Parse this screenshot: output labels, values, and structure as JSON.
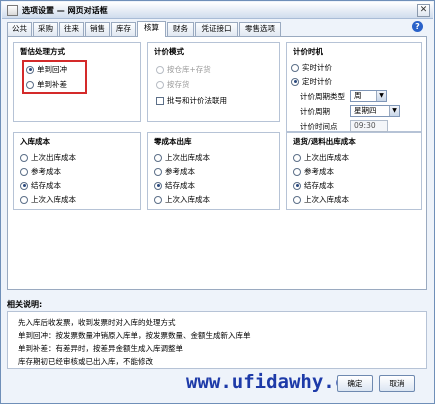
{
  "window": {
    "title": "选项设置 — 网页对话框",
    "close_glyph": "✕"
  },
  "help_glyph": "?",
  "tabs": [
    {
      "label": "公共"
    },
    {
      "label": "采购"
    },
    {
      "label": "往来"
    },
    {
      "label": "销售"
    },
    {
      "label": "库存"
    },
    {
      "label": "核算"
    },
    {
      "label": "财务"
    },
    {
      "label": "凭证接口"
    },
    {
      "label": "零售选项"
    }
  ],
  "active_tab": "核算",
  "group_temp": {
    "title": "暂估处理方式",
    "options": [
      "单到回冲",
      "单到补差"
    ],
    "selected": "单到回冲"
  },
  "group_pricing": {
    "title": "计价模式",
    "options": [
      "按仓库+存货",
      "按存货"
    ],
    "checkbox": "批号和计价法联用"
  },
  "group_timing": {
    "title": "计价时机",
    "options": [
      "实时计价",
      "定时计价"
    ],
    "selected": "定时计价",
    "period_type_label": "计价周期类型",
    "period_type_value": "周",
    "period_label": "计价周期",
    "period_value": "星期四",
    "time_label": "计价时间点",
    "time_value": "09:30"
  },
  "group_in_cost": {
    "title": "入库成本",
    "options": [
      "上次出库成本",
      "参考成本",
      "结存成本",
      "上次入库成本"
    ],
    "selected": "结存成本"
  },
  "group_zero_cost": {
    "title": "零成本出库",
    "options": [
      "上次出库成本",
      "参考成本",
      "结存成本",
      "上次入库成本"
    ],
    "selected": "结存成本"
  },
  "group_return_cost": {
    "title": "退货/退料出库成本",
    "options": [
      "上次出库成本",
      "参考成本",
      "结存成本",
      "上次入库成本"
    ],
    "selected": "结存成本"
  },
  "notes": {
    "title": "相关说明:",
    "lines": [
      "先入库后收发票，收到发票时对入库的处理方式",
      "单到回冲：按发票数量冲销原入库单，按发票数量、金额生成新入库单",
      "单到补差：有差异时，按差异金额生成入库调整单",
      "库存期初已经审核或已出入库，不能修改"
    ]
  },
  "buttons": {
    "ok": "确定",
    "cancel": "取消"
  },
  "watermark": "www.ufidawhy.com"
}
